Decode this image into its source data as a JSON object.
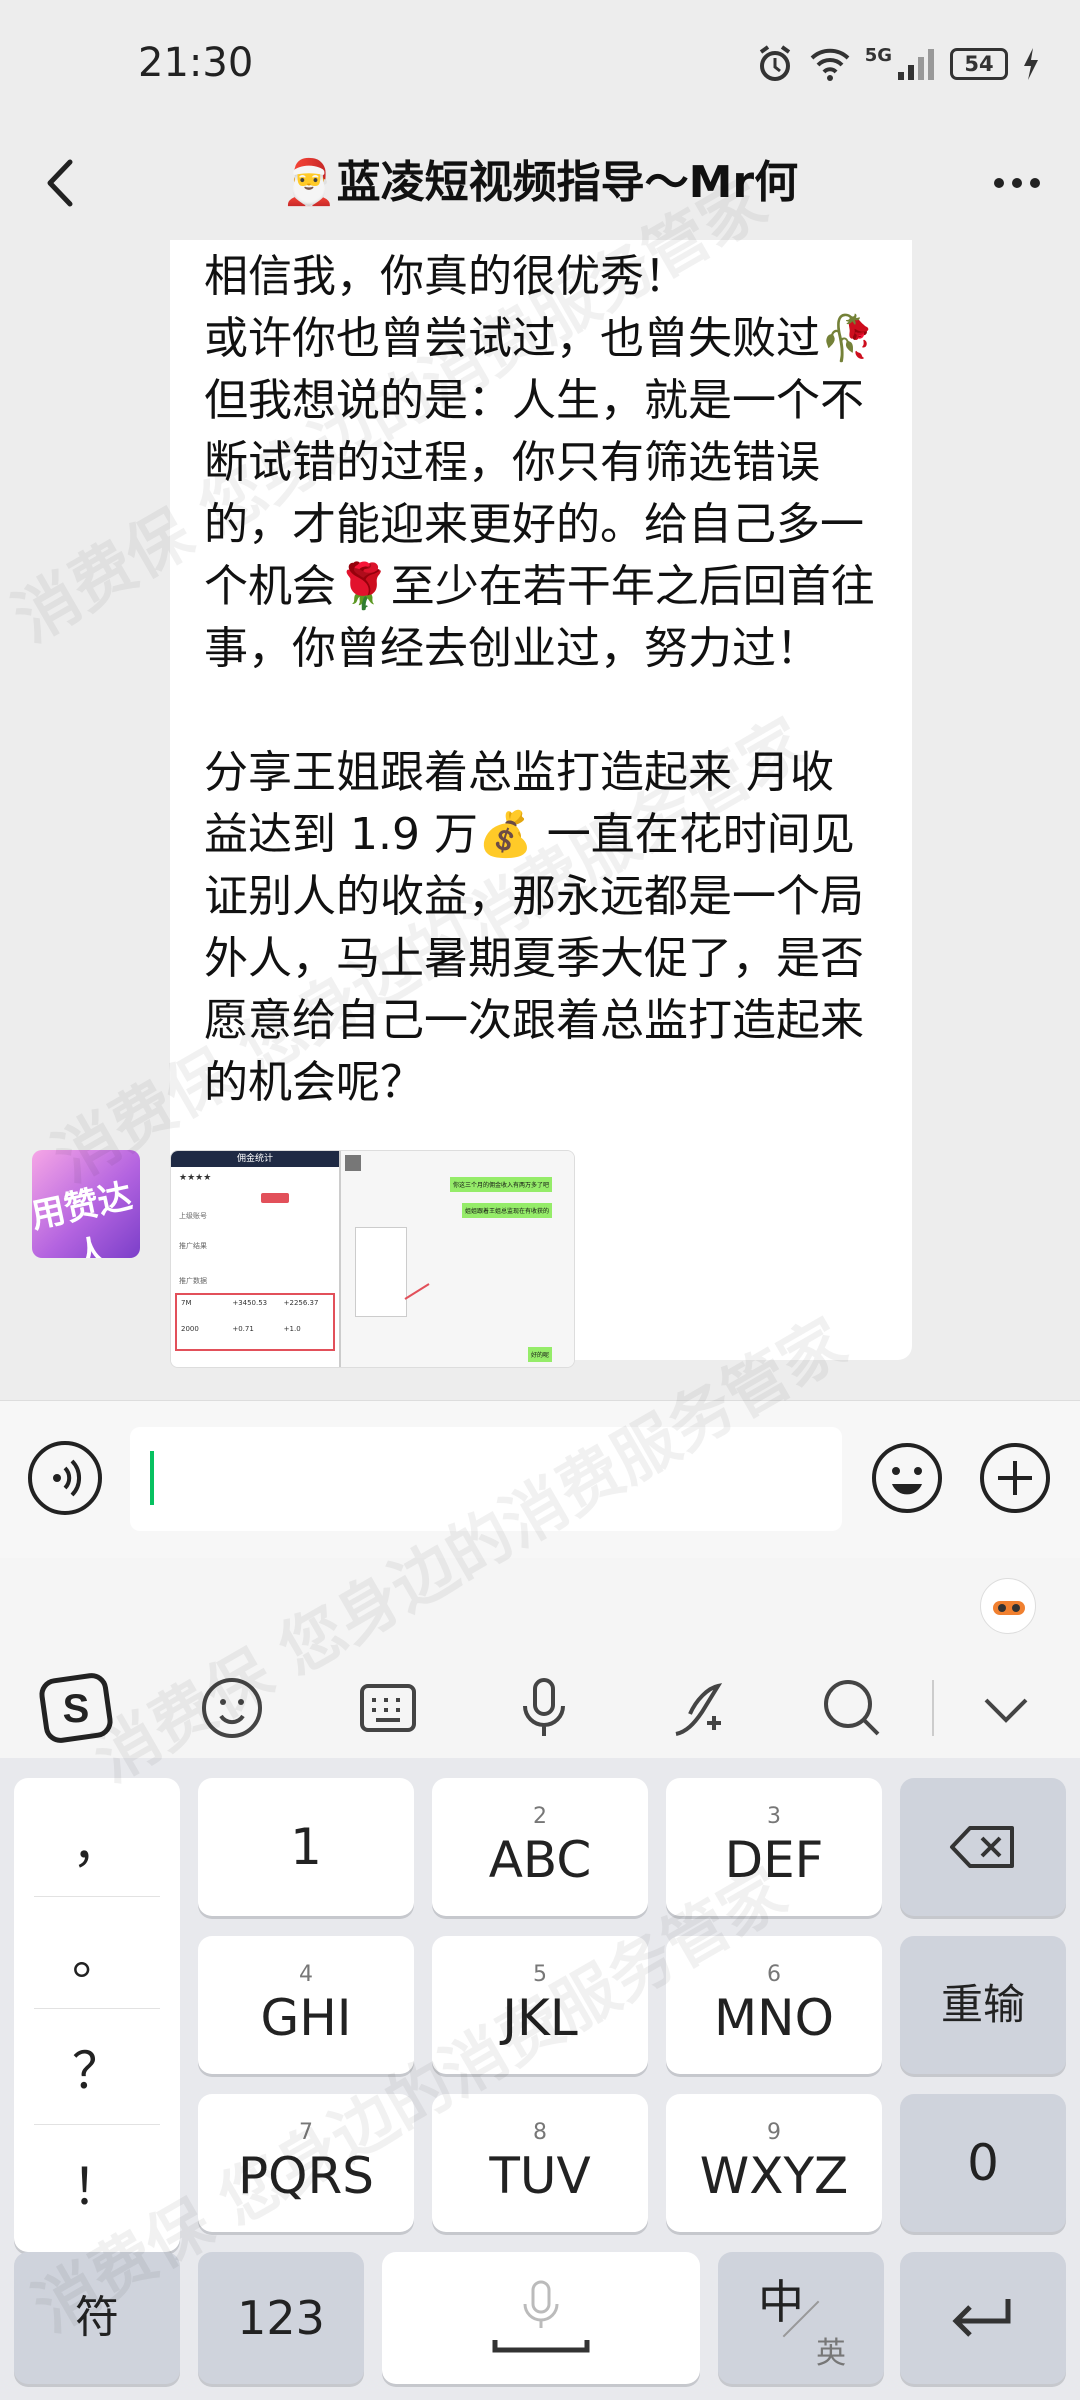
{
  "status_bar": {
    "time": "21:30",
    "network": "5G",
    "battery": "54"
  },
  "header": {
    "title": "🎅蓝凌短视频指导～Mr何"
  },
  "message": {
    "text": "一切自卑，把赚钱当做目标的你请\n相信我，你真的很优秀！\n或许你也曾尝试过，也曾失败过🥀\n但我想说的是：人生，就是一个不\n断试错的过程，你只有筛选错误\n的，才能迎来更好的。给自己多一\n个机会🌹至少在若干年之后回首往\n事，你曾经去创业过，努力过！\n\n分享王姐跟着总监打造起来 月收\n益达到 1.9 万💰 一直在花时间见\n证别人的收益，那永远都是一个局\n外人，马上暑期夏季大促了，是否\n愿意给自己一次跟着总监打造起来\n的机会呢？"
  },
  "avatar_text": "用赞达人",
  "screenshot_preview": {
    "left_title": "佣金统计",
    "left_rows": [
      "上级账号",
      "推广结果",
      "推广数据"
    ],
    "left_values": [
      "7M",
      "+3450.53",
      "+2256.37",
      "2000",
      "+0.71",
      "+1.0"
    ],
    "right_bubbles": [
      "你这三个月的佣金收入有两万多了吧",
      "姐姐跟着王姐总监现在有收获的",
      "好的呢"
    ]
  },
  "input": {
    "placeholder": ""
  },
  "ime_toolbar": [
    "sogou-logo-icon",
    "emoji-icon",
    "keyboard-icon",
    "mic-icon",
    "handwrite-icon",
    "search-icon",
    "collapse-icon"
  ],
  "keyboard": {
    "punct": [
      "，",
      "。",
      "？",
      "！"
    ],
    "rows": [
      [
        {
          "sub": "",
          "main": "1"
        },
        {
          "sub": "2",
          "main": "ABC"
        },
        {
          "sub": "3",
          "main": "DEF"
        }
      ],
      [
        {
          "sub": "4",
          "main": "GHI"
        },
        {
          "sub": "5",
          "main": "JKL"
        },
        {
          "sub": "6",
          "main": "MNO"
        }
      ],
      [
        {
          "sub": "7",
          "main": "PQRS"
        },
        {
          "sub": "8",
          "main": "TUV"
        },
        {
          "sub": "9",
          "main": "WXYZ"
        }
      ]
    ],
    "reinput": "重输",
    "zero": "0",
    "symbols": "符",
    "numbers": "123",
    "lang_main": "中",
    "lang_sub": "英"
  },
  "watermark": "消费保 您身边的消费服务管家"
}
